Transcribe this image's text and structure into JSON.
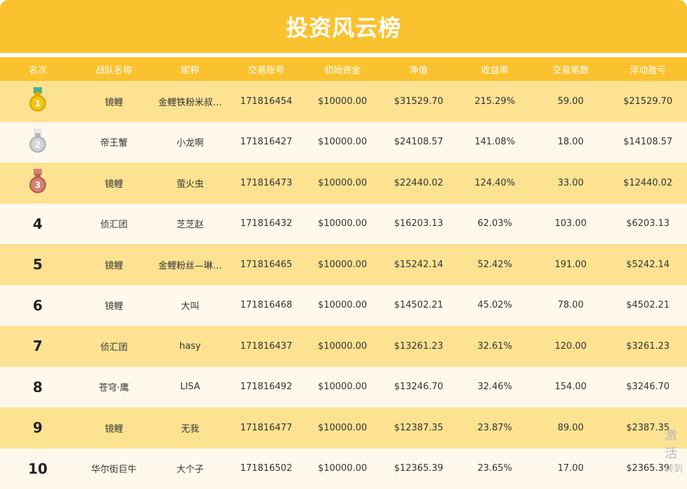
{
  "title": "投资风云榜",
  "columns": [
    "名次",
    "战队名称",
    "昵称",
    "交易账号",
    "初始资金",
    "净值",
    "收益率",
    "交易笔数",
    "浮动盈亏"
  ],
  "rows": [
    {
      "rank": "",
      "medal": "gold-medal-icon",
      "team": "镜鲤",
      "nickname": "金鲤铁粉米叔…",
      "account": "171816454",
      "initial": "$10000.00",
      "net": "$31529.70",
      "return": "215.29%",
      "trades": "59.00",
      "pnl": "$21529.70"
    },
    {
      "rank": "",
      "medal": "silver-medal-icon",
      "team": "帝王蟹",
      "nickname": "小龙啊",
      "account": "171816427",
      "initial": "$10000.00",
      "net": "$24108.57",
      "return": "141.08%",
      "trades": "18.00",
      "pnl": "$14108.57"
    },
    {
      "rank": "",
      "medal": "bronze-medal-icon",
      "team": "镜鲤",
      "nickname": "萤火虫",
      "account": "171816473",
      "initial": "$10000.00",
      "net": "$22440.02",
      "return": "124.40%",
      "trades": "33.00",
      "pnl": "$12440.02"
    },
    {
      "rank": "4",
      "team": "侦汇团",
      "nickname": "芝芝赵",
      "account": "171816432",
      "initial": "$10000.00",
      "net": "$16203.13",
      "return": "62.03%",
      "trades": "103.00",
      "pnl": "$6203.13"
    },
    {
      "rank": "5",
      "team": "镜鲤",
      "nickname": "金鲤粉丝—琳…",
      "account": "171816465",
      "initial": "$10000.00",
      "net": "$15242.14",
      "return": "52.42%",
      "trades": "191.00",
      "pnl": "$5242.14"
    },
    {
      "rank": "6",
      "team": "镜鲤",
      "nickname": "大叫",
      "account": "171816468",
      "initial": "$10000.00",
      "net": "$14502.21",
      "return": "45.02%",
      "trades": "78.00",
      "pnl": "$4502.21"
    },
    {
      "rank": "7",
      "team": "侦汇团",
      "nickname": "hasy",
      "account": "171816437",
      "initial": "$10000.00",
      "net": "$13261.23",
      "return": "32.61%",
      "trades": "120.00",
      "pnl": "$3261.23"
    },
    {
      "rank": "8",
      "team": "苍穹·鹰",
      "nickname": "LISA",
      "account": "171816492",
      "initial": "$10000.00",
      "net": "$13246.70",
      "return": "32.46%",
      "trades": "154.00",
      "pnl": "$3246.70"
    },
    {
      "rank": "9",
      "team": "镜鲤",
      "nickname": "无我",
      "account": "171816477",
      "initial": "$10000.00",
      "net": "$12387.35",
      "return": "23.87%",
      "trades": "89.00",
      "pnl": "$2387.35"
    },
    {
      "rank": "10",
      "team": "华尔街巨牛",
      "nickname": "大个子",
      "account": "171816502",
      "initial": "$10000.00",
      "net": "$12365.39",
      "return": "23.65%",
      "trades": "17.00",
      "pnl": "$2365.39"
    }
  ],
  "watermark": {
    "line1": "激活",
    "line2": "转到"
  },
  "colors": {
    "header": "#fbc22f",
    "row_odd": "#fde292",
    "row_even": "#fef9ec",
    "gold": "#f5c518",
    "silver": "#d4d4d4",
    "bronze": "#d4826e"
  }
}
